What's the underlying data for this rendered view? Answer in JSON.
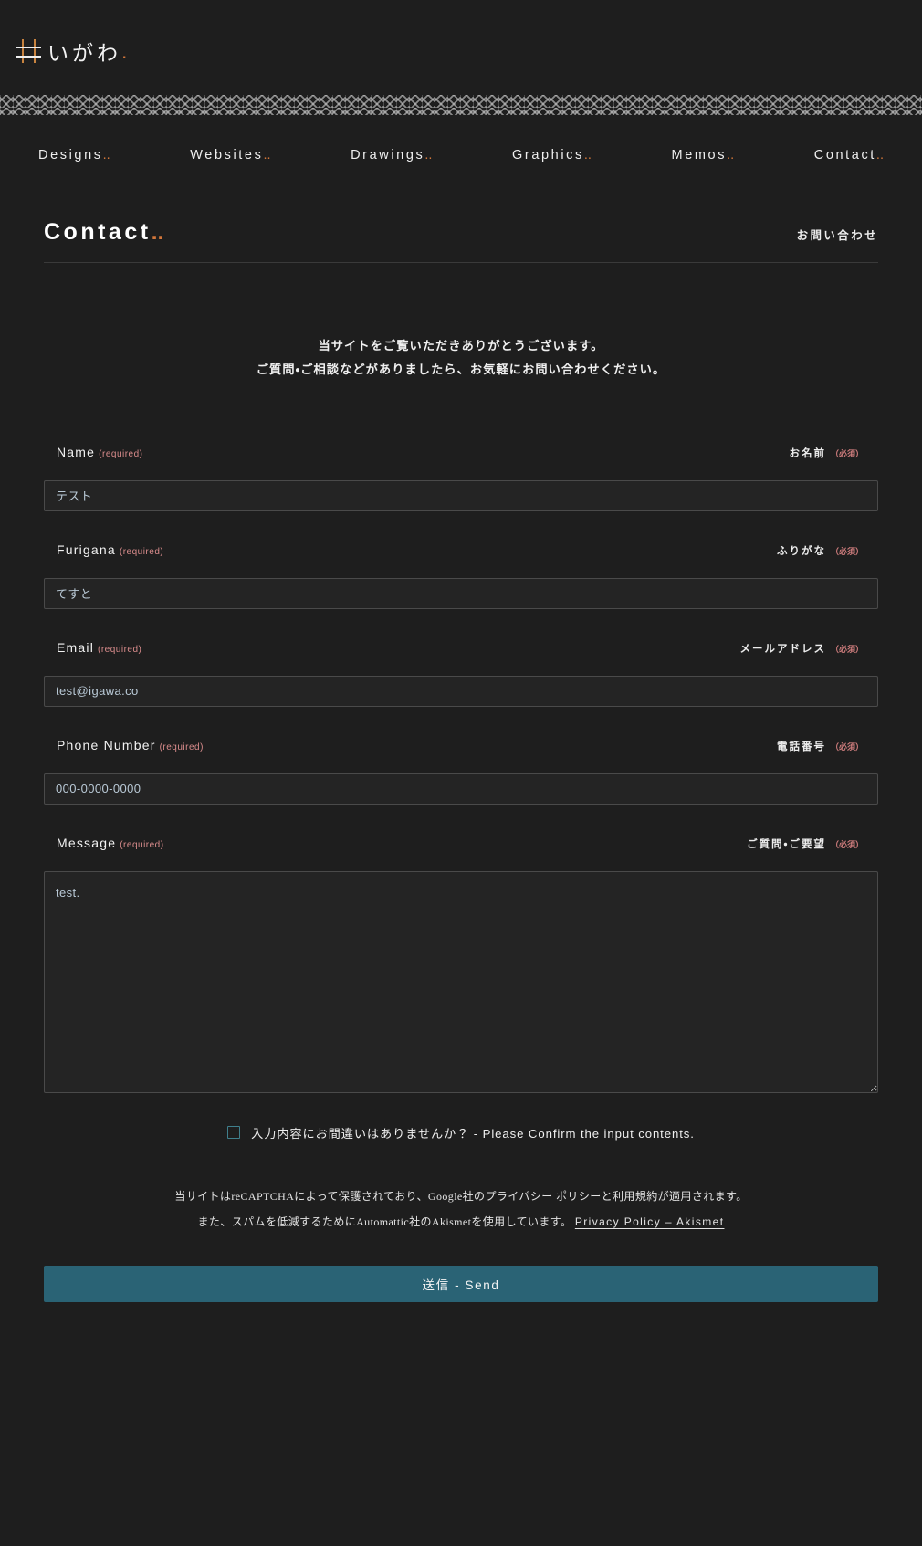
{
  "site": {
    "logo_icon": "igawa-well-mark-icon",
    "logo_text": "いがわ",
    "logo_dot": "."
  },
  "nav": {
    "items": [
      {
        "label": "Designs",
        "dots": ".."
      },
      {
        "label": "Websites",
        "dots": ".."
      },
      {
        "label": "Drawings",
        "dots": ".."
      },
      {
        "label": "Graphics",
        "dots": ".."
      },
      {
        "label": "Memos",
        "dots": ".."
      },
      {
        "label": "Contact",
        "dots": ".."
      }
    ]
  },
  "page": {
    "title": "Contact",
    "title_dots": "..",
    "title_ja": "お問い合わせ",
    "intro_line1": "当サイトをご覧いただきありがとうございます。",
    "intro_line2": "ご質問・ご相談などがありましたら、お気軽にお問い合わせください。"
  },
  "form": {
    "required_en": "(required)",
    "required_ja": "（必須）",
    "fields": [
      {
        "key": "name",
        "label_en": "Name",
        "label_ja": "お名前",
        "value": "テスト",
        "placeholder": "",
        "type": "text"
      },
      {
        "key": "furigana",
        "label_en": "Furigana",
        "label_ja": "ふりがな",
        "value": "てすと",
        "placeholder": "",
        "type": "text"
      },
      {
        "key": "email",
        "label_en": "Email",
        "label_ja": "メールアドレス",
        "value": "test@igawa.co",
        "placeholder": "",
        "type": "email"
      },
      {
        "key": "phone",
        "label_en": "Phone Number",
        "label_ja": "電話番号",
        "value": "000-0000-0000",
        "placeholder": "",
        "type": "tel"
      },
      {
        "key": "message",
        "label_en": "Message",
        "label_ja": "ご質問・ご要望",
        "value": "test.",
        "placeholder": "",
        "type": "textarea"
      }
    ],
    "confirm": {
      "checked": false,
      "label": "入力内容にお間違いはありませんか？ - Please Confirm the input contents."
    },
    "submit_label": "送信 - Send"
  },
  "legal": {
    "recaptcha_line": "当サイトはreCAPTCHAによって保護されており、Google社のプライバシー ポリシーと利用規約が適用されます。",
    "akismet_line": "また、スパムを低減するためにAutomattic社のAkismetを使用しています。",
    "akismet_link": "Privacy Policy – Akismet"
  },
  "colors": {
    "background": "#1e1e1e",
    "accent_orange": "#d2763a",
    "required_red": "#d98c8c",
    "input_text": "#b9c9d6",
    "submit_teal": "#2a6375",
    "checkbox_teal": "#3f7f8c",
    "border": "#4a4a4a"
  }
}
